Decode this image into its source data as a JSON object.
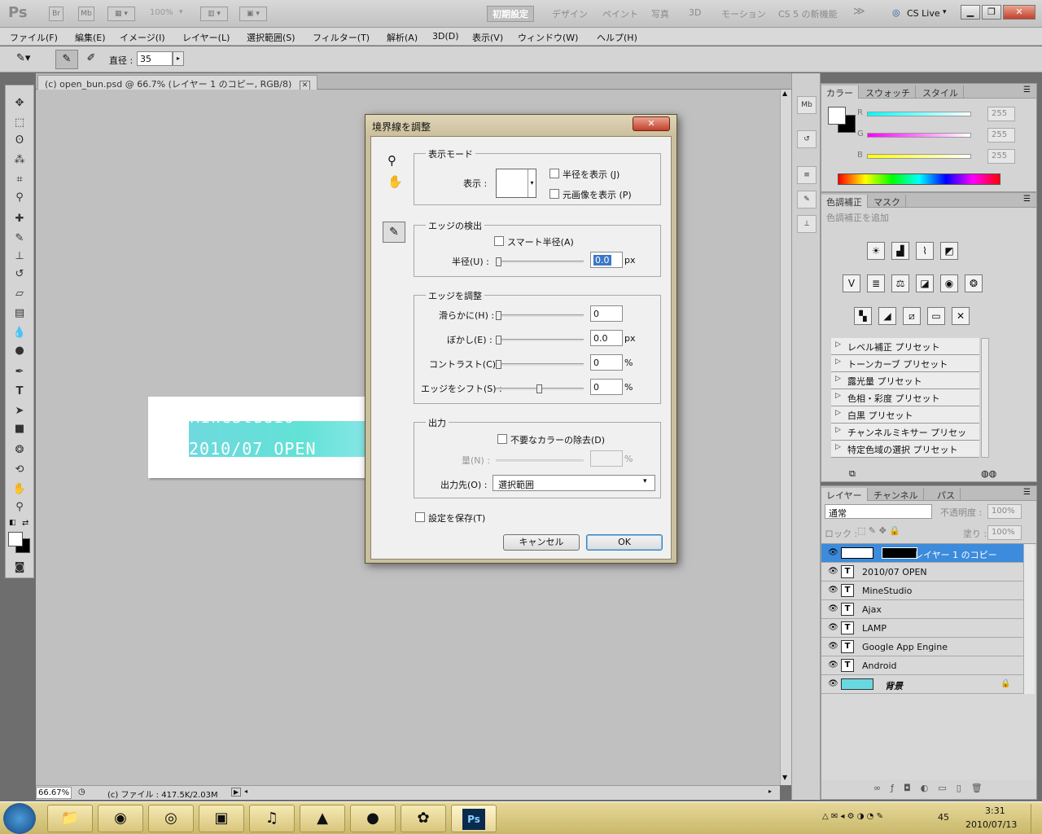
{
  "appbar": {
    "logo": "Ps",
    "btn_br": "Br",
    "btn_mb": "Mb",
    "zoom": "100%",
    "workspaces": [
      "初期設定",
      "デザイン",
      "ペイント",
      "写真",
      "3D",
      "モーション",
      "CS 5 の新機能"
    ],
    "more": "≫",
    "cslive": "CS Live"
  },
  "menu": [
    "ファイル(F)",
    "編集(E)",
    "イメージ(I)",
    "レイヤー(L)",
    "選択範囲(S)",
    "フィルター(T)",
    "解析(A)",
    "3D(D)",
    "表示(V)",
    "ウィンドウ(W)",
    "ヘルプ(H)"
  ],
  "options": {
    "diameter_label": "直径 :",
    "diameter_value": "35"
  },
  "document": {
    "tab_title": "(c) open_bun.psd @ 66.7% (レイヤー 1 のコピー, RGB/8)",
    "canvas_text_1": "MineStudio",
    "canvas_text_2": "2010/07 OPEN",
    "zoom": "66.67%",
    "file_info": "(c) ファイル : 417.5K/2.03M"
  },
  "color_panel": {
    "tabs": [
      "カラー",
      "スウォッチ",
      "スタイル"
    ],
    "r_label": "R",
    "g_label": "G",
    "b_label": "B",
    "r": "255",
    "g": "255",
    "b": "255"
  },
  "adjust_panel": {
    "tabs": [
      "色調補正",
      "マスク"
    ],
    "hint": "色調補正を追加",
    "presets": [
      "レベル補正 プリセット",
      "トーンカーブ プリセット",
      "露光量 プリセット",
      "色相・彩度 プリセット",
      "白黒 プリセット",
      "チャンネルミキサー プリセット",
      "特定色域の選択 プリセット"
    ]
  },
  "layers_panel": {
    "tabs": [
      "レイヤー",
      "チャンネル",
      "パス"
    ],
    "blend_mode": "通常",
    "opacity_label": "不透明度 :",
    "opacity": "100%",
    "lock_label": "ロック :",
    "fill_label": "塗り :",
    "fill": "100%",
    "layers": [
      {
        "name": "レイヤー 1 のコピー"
      },
      {
        "name": "2010/07 OPEN"
      },
      {
        "name": "MineStudio"
      },
      {
        "name": "Ajax"
      },
      {
        "name": "LAMP"
      },
      {
        "name": "Google App Engine"
      },
      {
        "name": "Android"
      },
      {
        "name": "背景"
      }
    ]
  },
  "dialog": {
    "title": "境界線を調整",
    "close": "✕",
    "view_mode_group": "表示モード",
    "view_label": "表示 :",
    "show_radius": "半径を表示 (J)",
    "show_original": "元画像を表示 (P)",
    "edge_detect_group": "エッジの検出",
    "smart_radius": "スマート半径(A)",
    "radius_label": "半径(U) :",
    "radius_value": "0.0",
    "unit_px": "px",
    "adjust_edge_group": "エッジを調整",
    "smooth_label": "滑らかに(H) :",
    "smooth_value": "0",
    "feather_label": "ぼかし(E) :",
    "feather_value": "0.0",
    "contrast_label": "コントラスト(C) :",
    "contrast_value": "0",
    "shift_label": "エッジをシフト(S) :",
    "shift_value": "0",
    "unit_pct": "%",
    "output_group": "出力",
    "decontam": "不要なカラーの除去(D)",
    "amount_label": "量(N) :",
    "output_to_label": "出力先(O) :",
    "output_to_value": "選択範囲",
    "remember": "設定を保存(T)",
    "cancel": "キャンセル",
    "ok": "OK"
  },
  "taskbar": {
    "time": "3:31",
    "date": "2010/07/13",
    "ime": "45"
  }
}
